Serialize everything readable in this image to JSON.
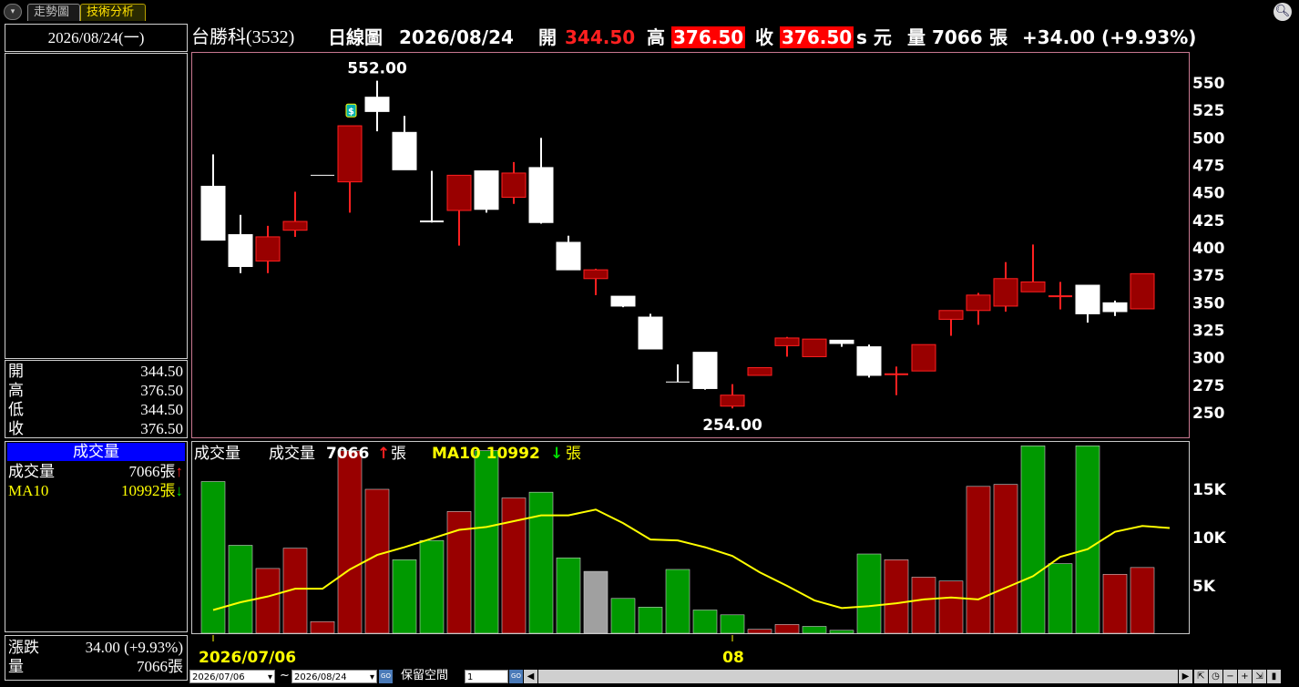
{
  "tabs": {
    "menu_glyph": "▾",
    "trend": "走勢圖",
    "tech": "技術分析"
  },
  "left": {
    "date": "2026/08/24(一)",
    "ohlc": [
      {
        "k": "開",
        "v": "344.50"
      },
      {
        "k": "高",
        "v": "376.50"
      },
      {
        "k": "低",
        "v": "344.50"
      },
      {
        "k": "收",
        "v": "376.50"
      }
    ],
    "vol_title": "成交量",
    "vol_rows": [
      {
        "k": "成交量",
        "v": "7066張",
        "arrow": "↑",
        "color": "#ffffff",
        "arrow_color": "#ff2020"
      },
      {
        "k": "MA10",
        "v": "10992張",
        "arrow": "↓",
        "color": "#ffff00",
        "arrow_color": "#00e000"
      }
    ],
    "chg_rows": [
      {
        "k": "漲跌",
        "v": "34.00 (+9.93%)"
      },
      {
        "k": "量",
        "v": "7066張"
      }
    ]
  },
  "header": {
    "stock": "台勝科(3532)",
    "chart_name": "日線圖",
    "date": "2026/08/24",
    "open_label": "開",
    "open": "344.50",
    "high_label": "高",
    "high": "376.50",
    "close_label": "收",
    "close": "376.50",
    "unit": "s 元",
    "vol_label": "量",
    "vol": "7066",
    "vol_unit": "張",
    "change": "+34.00 (+9.93%)"
  },
  "colors": {
    "up": "#990000",
    "up_border": "#ff2020",
    "down": "#ffffff",
    "vol_up": "#990000",
    "vol_down": "#009900",
    "vol_flat": "#a0a0a0",
    "ma": "#ffff00"
  },
  "chart_data": [
    {
      "type": "candlestick",
      "x_start": "2026/07/06",
      "x_end": "2026/08/24",
      "x_tick_labels": [
        "2026/07/06",
        "08"
      ],
      "y_ticks": [
        250,
        275,
        300,
        325,
        350,
        375,
        400,
        425,
        450,
        475,
        500,
        525,
        550
      ],
      "ylim": [
        240,
        580
      ],
      "annotations": [
        {
          "text": "552.00",
          "index": 6
        },
        {
          "text": "254.00",
          "index": 19
        }
      ],
      "event_marker": {
        "index": 5,
        "glyph": "$"
      },
      "candles": [
        {
          "o": 407,
          "h": 485,
          "l": 407,
          "c": 456,
          "dir": "down"
        },
        {
          "o": 412,
          "h": 430,
          "l": 377,
          "c": 383,
          "dir": "down"
        },
        {
          "o": 388,
          "h": 420,
          "l": 377,
          "c": 410,
          "dir": "up"
        },
        {
          "o": 416,
          "h": 451,
          "l": 410,
          "c": 424,
          "dir": "up"
        },
        {
          "o": 466,
          "h": 466,
          "l": 466,
          "c": 466,
          "dir": "flat"
        },
        {
          "o": 460,
          "h": 510,
          "l": 432,
          "c": 511,
          "dir": "up"
        },
        {
          "o": 537,
          "h": 552,
          "l": 506,
          "c": 524,
          "dir": "down"
        },
        {
          "o": 505,
          "h": 520,
          "l": 471,
          "c": 471,
          "dir": "down"
        },
        {
          "o": 424,
          "h": 470,
          "l": 423,
          "c": 424,
          "dir": "down"
        },
        {
          "o": 434,
          "h": 466,
          "l": 402,
          "c": 466,
          "dir": "up"
        },
        {
          "o": 470,
          "h": 470,
          "l": 432,
          "c": 435,
          "dir": "down"
        },
        {
          "o": 446,
          "h": 478,
          "l": 440,
          "c": 468,
          "dir": "up"
        },
        {
          "o": 473,
          "h": 500,
          "l": 422,
          "c": 423,
          "dir": "down"
        },
        {
          "o": 405,
          "h": 411,
          "l": 380,
          "c": 380,
          "dir": "down"
        },
        {
          "o": 372,
          "h": 381,
          "l": 357,
          "c": 380,
          "dir": "up"
        },
        {
          "o": 356,
          "h": 356,
          "l": 346,
          "c": 347,
          "dir": "down"
        },
        {
          "o": 337,
          "h": 340,
          "l": 308,
          "c": 308,
          "dir": "down"
        },
        {
          "o": 278,
          "h": 294,
          "l": 278,
          "c": 278,
          "dir": "flat"
        },
        {
          "o": 305,
          "h": 305,
          "l": 271,
          "c": 272,
          "dir": "down"
        },
        {
          "o": 256,
          "h": 276,
          "l": 254,
          "c": 266,
          "dir": "up"
        },
        {
          "o": 284,
          "h": 291,
          "l": 284,
          "c": 291,
          "dir": "up"
        },
        {
          "o": 311,
          "h": 319,
          "l": 301,
          "c": 318,
          "dir": "up"
        },
        {
          "o": 301,
          "h": 317,
          "l": 301,
          "c": 317,
          "dir": "up"
        },
        {
          "o": 316,
          "h": 316,
          "l": 310,
          "c": 313,
          "dir": "down"
        },
        {
          "o": 310,
          "h": 312,
          "l": 282,
          "c": 284,
          "dir": "down"
        },
        {
          "o": 284,
          "h": 292,
          "l": 266,
          "c": 285,
          "dir": "up"
        },
        {
          "o": 288,
          "h": 312,
          "l": 288,
          "c": 312,
          "dir": "up"
        },
        {
          "o": 335,
          "h": 342,
          "l": 320,
          "c": 343,
          "dir": "up"
        },
        {
          "o": 343,
          "h": 359,
          "l": 330,
          "c": 357,
          "dir": "up"
        },
        {
          "o": 347,
          "h": 387,
          "l": 342,
          "c": 372,
          "dir": "up"
        },
        {
          "o": 360,
          "h": 403,
          "l": 360,
          "c": 369,
          "dir": "up"
        },
        {
          "o": 355,
          "h": 369,
          "l": 344,
          "c": 356,
          "dir": "up"
        },
        {
          "o": 366,
          "h": 366,
          "l": 332,
          "c": 340,
          "dir": "down"
        },
        {
          "o": 350,
          "h": 352,
          "l": 338,
          "c": 342,
          "dir": "down"
        },
        {
          "o": 344.5,
          "h": 376.5,
          "l": 344.5,
          "c": 376.5,
          "dir": "up"
        }
      ]
    },
    {
      "type": "bar",
      "title": "成交量",
      "legend": [
        {
          "label": "成交量",
          "value": "7066",
          "arrow": "↑",
          "unit": "張"
        },
        {
          "label": "MA10",
          "value": "10992",
          "arrow": "↓",
          "unit": "張"
        }
      ],
      "y_ticks": [
        5000,
        10000,
        15000
      ],
      "y_tick_labels": [
        "5K",
        "10K",
        "15K"
      ],
      "ylim": [
        0,
        19500
      ],
      "values": [
        15800,
        9200,
        6800,
        8900,
        1300,
        19000,
        15000,
        7700,
        9700,
        12700,
        19000,
        14100,
        14700,
        7900,
        6500,
        3700,
        2800,
        6700,
        2500,
        2000,
        500,
        1000,
        800,
        400,
        8300,
        7700,
        5900,
        5500,
        15300,
        15500,
        19500,
        7300,
        19500,
        6200,
        6900
      ],
      "colors": [
        "down",
        "down",
        "up",
        "up",
        "up",
        "up",
        "up",
        "down",
        "down",
        "up",
        "down",
        "up",
        "down",
        "down",
        "flat",
        "down",
        "down",
        "down",
        "down",
        "down",
        "up",
        "up",
        "down",
        "down",
        "down",
        "up",
        "up",
        "up",
        "up",
        "up",
        "down",
        "down",
        "down",
        "up",
        "up"
      ],
      "ma10": [
        2500,
        3300,
        3900,
        4700,
        4700,
        6700,
        8200,
        9000,
        9900,
        10800,
        11100,
        11700,
        12300,
        12300,
        12900,
        11500,
        9800,
        9700,
        9000,
        8100,
        6400,
        5000,
        3500,
        2700,
        2900,
        3200,
        3600,
        3800,
        3600,
        4800,
        6000,
        8000,
        8800,
        10600,
        11200,
        10992
      ]
    }
  ],
  "bottom": {
    "from_date": "2026/07/06",
    "tilde": "~",
    "to_date": "2026/08/24",
    "go": "GO",
    "reserve_label": "保留空間",
    "reserve_value": "1",
    "icons": [
      "⇱",
      "◷",
      "−",
      "+",
      "⇲",
      "▶",
      "▮"
    ]
  }
}
